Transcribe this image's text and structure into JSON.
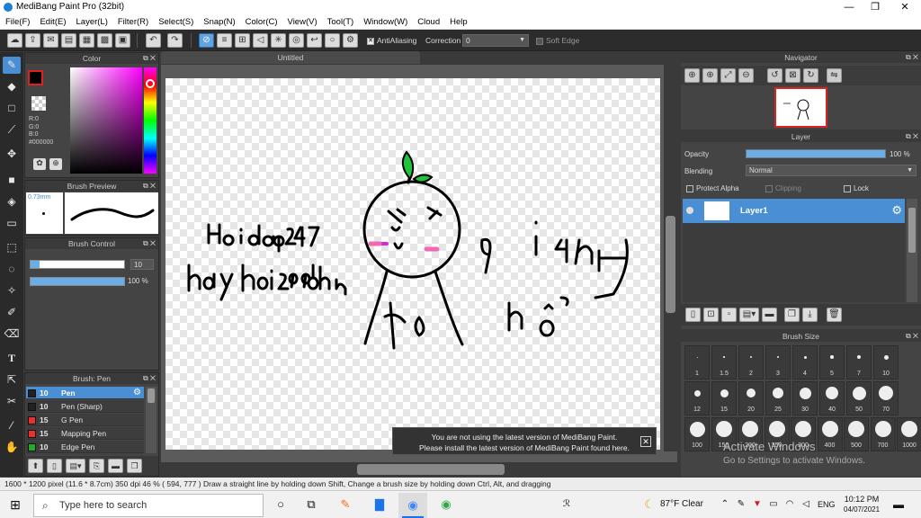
{
  "app": {
    "title": "MediBang Paint Pro (32bit)"
  },
  "menu": [
    "File(F)",
    "Edit(E)",
    "Layer(L)",
    "Filter(R)",
    "Select(S)",
    "Snap(N)",
    "Color(C)",
    "View(V)",
    "Tool(T)",
    "Window(W)",
    "Cloud",
    "Help"
  ],
  "toolbar": {
    "antialias_label": "AntiAliasing",
    "correction_label": "Correction",
    "correction_value": "0",
    "soft_edge_label": "Soft Edge"
  },
  "color_panel": {
    "title": "Color",
    "r": "R:0",
    "g": "G:0",
    "b": "B:0",
    "hex": "#000000",
    "fg": "#000000"
  },
  "brush_preview": {
    "title": "Brush Preview",
    "size": "0.73mm"
  },
  "brush_control": {
    "title": "Brush Control",
    "size_value": "10",
    "opacity_value": "100 %",
    "size_fraction": 0.1,
    "opacity_fraction": 1.0
  },
  "brush_list": {
    "title": "Brush: Pen",
    "items": [
      {
        "size": "10",
        "name": "Pen",
        "color": "#222222",
        "selected": true
      },
      {
        "size": "10",
        "name": "Pen (Sharp)",
        "color": "#222222"
      },
      {
        "size": "15",
        "name": "G Pen",
        "color": "#e83030"
      },
      {
        "size": "15",
        "name": "Mapping Pen",
        "color": "#e83030"
      },
      {
        "size": "10",
        "name": "Edge Pen",
        "color": "#22aa22"
      }
    ]
  },
  "document": {
    "tab": "Untitled"
  },
  "notification": {
    "line1": "You are not using the latest version of MediBang Paint.",
    "line2": "Please install the latest version of MediBang Paint found here."
  },
  "navigator": {
    "title": "Navigator"
  },
  "layer_panel": {
    "title": "Layer",
    "opacity_label": "Opacity",
    "opacity_value": "100 %",
    "opacity_fraction": 1.0,
    "blending_label": "Blending",
    "blending_value": "Normal",
    "protect_alpha": "Protect Alpha",
    "clipping": "Clipping",
    "lock": "Lock",
    "layers": [
      {
        "name": "Layer1"
      }
    ]
  },
  "brush_size": {
    "title": "Brush Size",
    "sizes": [
      "1",
      "1.5",
      "2",
      "3",
      "4",
      "5",
      "7",
      "10",
      "12",
      "15",
      "20",
      "25",
      "30",
      "40",
      "50",
      "70",
      "100",
      "150",
      "200",
      "250",
      "300",
      "400",
      "500",
      "700",
      "1000"
    ]
  },
  "watermark": {
    "line1": "Activate Windows",
    "line2": "Go to Settings to activate Windows."
  },
  "status": {
    "info": "1600 * 1200 pixel   (11.6 * 8.7cm)   350 dpi   46 %   ( 594, 777 )   Draw a straight line by holding down Shift, Change a brush size by holding down Ctrl, Alt, and dragging"
  },
  "taskbar": {
    "search_placeholder": "Type here to search",
    "weather": "87°F  Clear",
    "lang": "ENG",
    "time": "10:12 PM",
    "date": "04/07/2021"
  },
  "drawing": {
    "text1": "Hoidap247",
    "text2": "hay hoi:298bhn",
    "text3": "giahoi",
    "text4": "hỏi"
  }
}
